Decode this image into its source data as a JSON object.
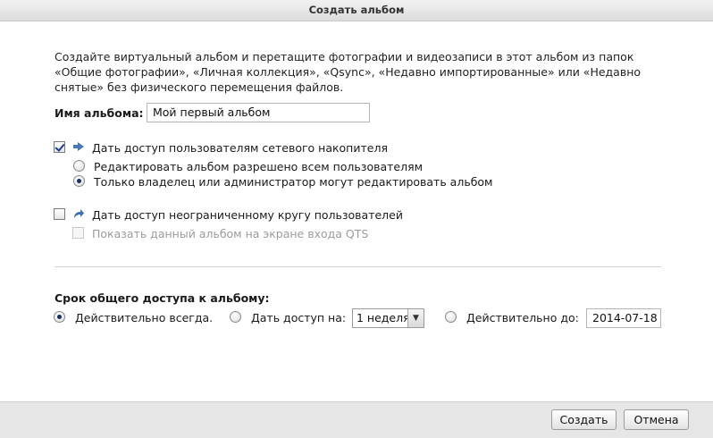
{
  "dialog": {
    "title": "Создать альбом"
  },
  "description": "Создайте виртуальный альбом и перетащите фотографии и видеозаписи в этот альбом из папок «Общие фотографии», «Личная коллекция», «Qsync», «Недавно импортированные» или «Недавно снятые» без физического перемещения файлов.",
  "album_name": {
    "label": "Имя альбома:",
    "value": "Мой первый альбом"
  },
  "nas_share": {
    "label": "Дать доступ пользователям сетевого накопителя",
    "checked": true,
    "icon": "share-icon",
    "options": [
      {
        "label": "Редактировать альбом разрешено всем пользователям",
        "selected": false
      },
      {
        "label": "Только владелец или администратор могут редактировать альбом",
        "selected": true
      }
    ]
  },
  "public_share": {
    "label": "Дать доступ неограниченному кругу пользователей",
    "checked": false,
    "icon": "arrow-share-icon",
    "show_on_login": {
      "label": "Показать данный альбом на экране входа QTS",
      "checked": false,
      "disabled": true
    }
  },
  "period": {
    "heading": "Срок общего доступа к альбому:",
    "always": {
      "label": "Действительно всегда.",
      "selected": true
    },
    "share_for": {
      "label": "Дать доступ на:",
      "selected": false,
      "value": "1 неделя"
    },
    "valid_until": {
      "label": "Действительно до:",
      "selected": false,
      "value": "2014-07-18"
    }
  },
  "buttons": {
    "create": "Создать",
    "cancel": "Отмена"
  }
}
